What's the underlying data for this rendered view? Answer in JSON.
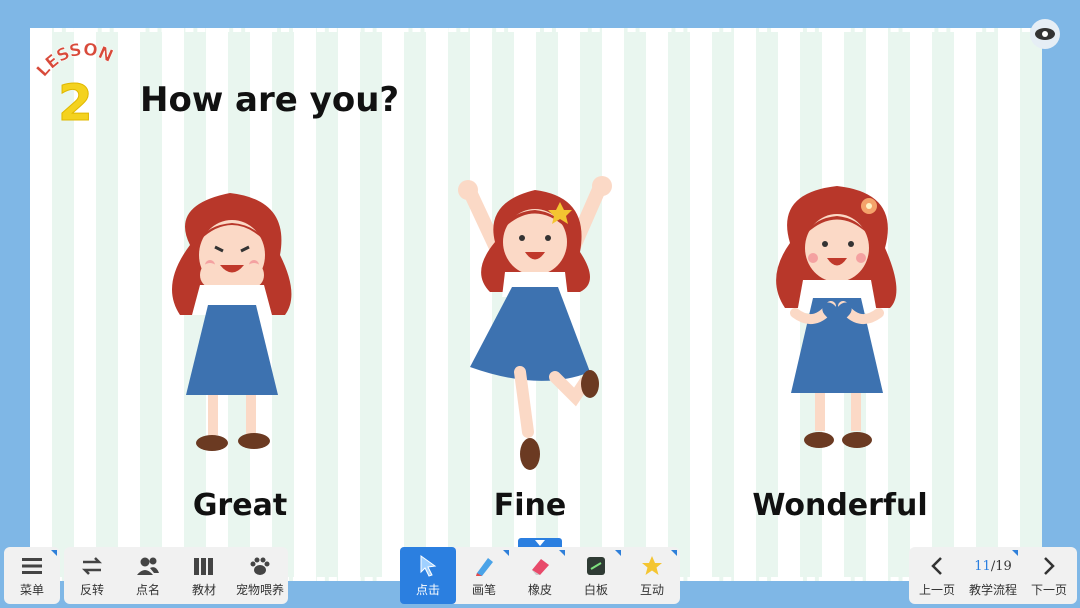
{
  "lesson": {
    "word": "LESSON",
    "number": "2"
  },
  "title": "How are you?",
  "cards": [
    {
      "label": "Great"
    },
    {
      "label": "Fine"
    },
    {
      "label": "Wonderful"
    }
  ],
  "toolbar_left": [
    {
      "label": "菜单",
      "icon": "menu-icon"
    },
    {
      "label": "反转",
      "icon": "swap-icon"
    },
    {
      "label": "点名",
      "icon": "users-icon"
    },
    {
      "label": "教材",
      "icon": "books-icon"
    },
    {
      "label": "宠物喂养",
      "icon": "paw-icon"
    }
  ],
  "toolbar_center": [
    {
      "label": "点击",
      "icon": "cursor-icon",
      "active": true
    },
    {
      "label": "画笔",
      "icon": "pen-icon"
    },
    {
      "label": "橡皮",
      "icon": "eraser-icon"
    },
    {
      "label": "白板",
      "icon": "whiteboard-icon"
    },
    {
      "label": "互动",
      "icon": "star-icon"
    }
  ],
  "toolbar_right": {
    "prev": "上一页",
    "page_current": "11",
    "page_total": "/19",
    "flow": "教学流程",
    "next": "下一页"
  },
  "colors": {
    "frame": "#7fb7e6",
    "accent": "#2b7fe0",
    "dress": "#3d72b0",
    "hair": "#b8372a"
  }
}
